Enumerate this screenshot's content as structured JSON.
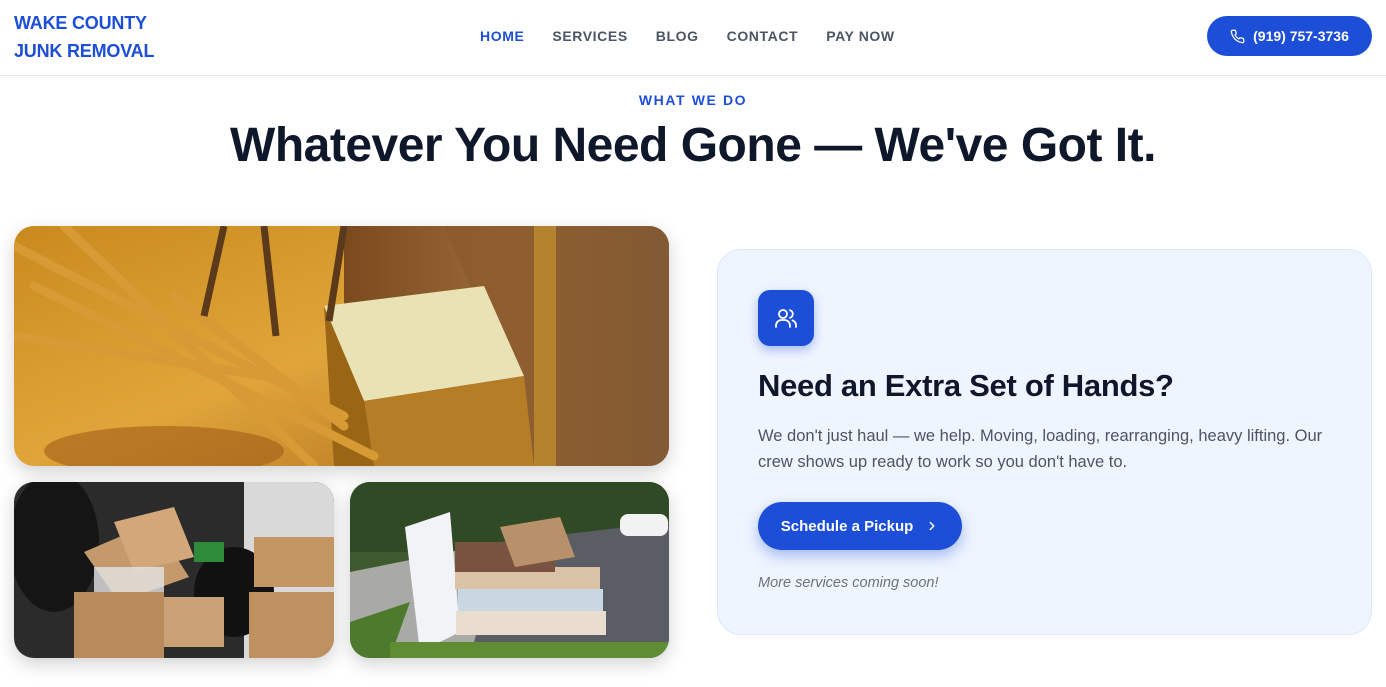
{
  "header": {
    "logo_line1": "WAKE COUNTY",
    "logo_line2": "JUNK REMOVAL",
    "nav": [
      {
        "label": "HOME",
        "active": true
      },
      {
        "label": "SERVICES",
        "active": false
      },
      {
        "label": "BLOG",
        "active": false
      },
      {
        "label": "CONTACT",
        "active": false
      },
      {
        "label": "PAY NOW",
        "active": false
      }
    ],
    "phone_icon": "phone-icon",
    "phone_label": "(919) 757-3736"
  },
  "section": {
    "eyebrow": "WHAT WE DO",
    "headline": "Whatever You Need Gone — We've Got It."
  },
  "card": {
    "icon": "users-icon",
    "title": "Need an Extra Set of Hands?",
    "description": "We don't just haul — we help. Moving, loading, rearranging, heavy lifting. Our crew shows up ready to work so you don't have to.",
    "button_label": "Schedule a Pickup",
    "button_icon": "chevron-right-icon",
    "note": "More services coming soon!"
  },
  "colors": {
    "brand": "#1d4ed8",
    "card_bg": "#eff5ff",
    "heading": "#0f172a",
    "body_text": "#4b5563"
  }
}
